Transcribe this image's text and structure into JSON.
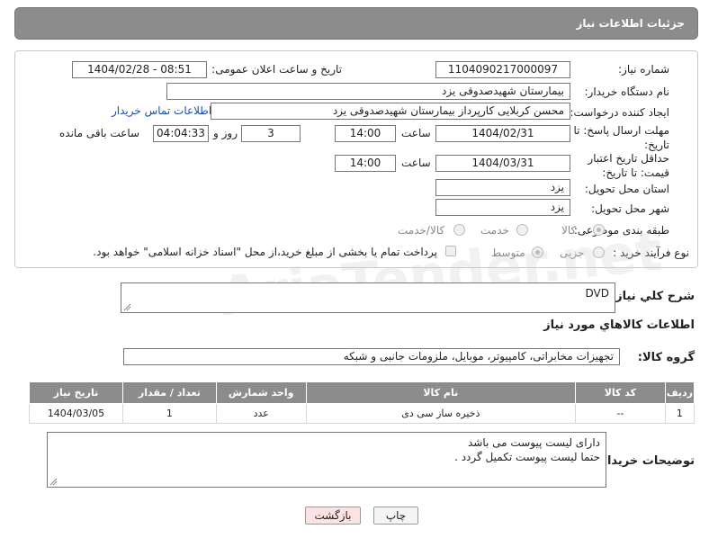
{
  "header": {
    "title": "جزئیات اطلاعات نیاز"
  },
  "fields": {
    "need_number_label": "شماره نیاز:",
    "need_number": "1104090217000097",
    "announce_label": "تاریخ و ساعت اعلان عمومی:",
    "announce_value": "1404/02/28 - 08:51",
    "buyer_org_label": "نام دستگاه خریدار:",
    "buyer_org": "بیمارستان شهیدصدوقی یزد",
    "creator_label": "ایجاد کننده درخواست:",
    "creator": "محسن کربلایی کارپرداز بیمارستان شهیدصدوقی یزد",
    "contact_link": "اطلاعات تماس خریدار",
    "deadline_label": "مهلت ارسال پاسخ: تا تاریخ:",
    "deadline_date": "1404/02/31",
    "time_label": "ساعت",
    "deadline_time": "14:00",
    "days_value": "3",
    "days_label": "روز و",
    "remaining_time": "04:04:33",
    "remaining_label": "ساعت باقی مانده",
    "validity_label": "حداقل تاریخ اعتبار قیمت: تا تاریخ:",
    "validity_date": "1404/03/31",
    "validity_time": "14:00",
    "province_label": "استان محل تحویل:",
    "province": "یزد",
    "city_label": "شهر محل تحویل:",
    "city": "یزد",
    "category_label": "طبقه بندی موضوعی:",
    "category_options": [
      "کالا",
      "خدمت",
      "کالا/خدمت"
    ],
    "process_label": "نوع فرآیند خرید :",
    "process_options": [
      "جزیی",
      "متوسط"
    ],
    "payment_note": "پرداخت تمام یا بخشی از مبلغ خرید،از محل \"اسناد خزانه اسلامی\" خواهد بود."
  },
  "summary": {
    "label": "شرح کلي نياز:",
    "value": "DVD"
  },
  "goods_section_title": "اطلاعات کالاهاي مورد نياز",
  "goods_group": {
    "label": "گروه کالا:",
    "value": "تجهیزات مخابراتی، کامپیوتر، موبایل، ملزومات جانبی و شبکه"
  },
  "table": {
    "headers": [
      "ردیف",
      "کد کالا",
      "نام کالا",
      "واحد شمارش",
      "تعداد / مقدار",
      "تاریخ نیاز"
    ],
    "rows": [
      [
        "1",
        "--",
        "ذخیره ساز سی دی",
        "عدد",
        "1",
        "1404/03/05"
      ]
    ]
  },
  "buyer_notes": {
    "label": "توضیحات خریدار:",
    "line1": "دارای لیست پیوست می باشد",
    "line2": "حتما لیست پیوست تکمیل گردد ."
  },
  "buttons": {
    "print": "چاپ",
    "back": "بازگشت"
  },
  "watermark": "AriaTender.net"
}
